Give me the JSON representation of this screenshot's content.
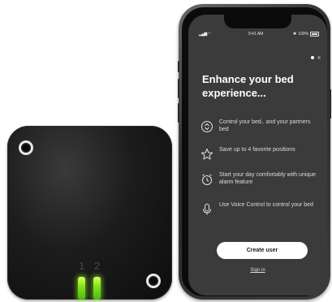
{
  "device": {
    "port_labels": [
      "1",
      "2"
    ],
    "led_color": "#8cf01e"
  },
  "phone": {
    "status_bar": {
      "time": "9:41 AM",
      "battery": "100%"
    },
    "pager": {
      "current_page": 1,
      "total_pages": 2
    },
    "headline": "Enhance your bed experience...",
    "features": [
      {
        "icon": "bed-control-icon",
        "text": "Control your bed.. and your partners bed"
      },
      {
        "icon": "star-icon",
        "text": "Save up to 4 favorite positions"
      },
      {
        "icon": "alarm-clock-icon",
        "text": "Start your day comfortably with unique alarm feature"
      },
      {
        "icon": "microphone-icon",
        "text": "Use Voice Control to control your bed"
      }
    ],
    "create_user_label": "Create user",
    "sign_in_label": "Sign in",
    "screen_color": "#3b3b3b"
  }
}
